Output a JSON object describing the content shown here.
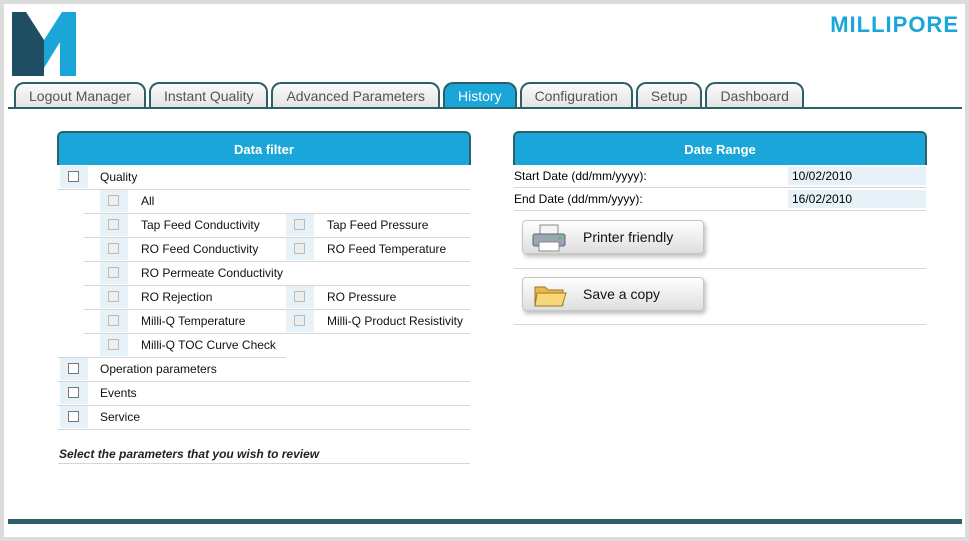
{
  "brand": "MILLIPORE",
  "logo_letter": "M",
  "tabs": [
    "Logout Manager",
    "Instant Quality",
    "Advanced Parameters",
    "History",
    "Configuration",
    "Setup",
    "Dashboard"
  ],
  "active_tab": "History",
  "data_filter": {
    "title": "Data filter",
    "quality": "Quality",
    "all": "All",
    "params_left": [
      "Tap Feed Conductivity",
      "RO Feed Conductivity",
      "RO Permeate Conductivity",
      "RO Rejection",
      "Milli-Q Temperature",
      "Milli-Q TOC Curve Check"
    ],
    "params_right": [
      "Tap Feed Pressure",
      "RO Feed Temperature",
      "",
      "RO Pressure",
      "Milli-Q Product Resistivity",
      ""
    ],
    "operation": "Operation parameters",
    "events": "Events",
    "service": "Service",
    "hint": "Select the parameters that you wish to review"
  },
  "date_range": {
    "title": "Date Range",
    "start_label": "Start Date (dd/mm/yyyy):",
    "start_value": "10/02/2010",
    "end_label": "End Date (dd/mm/yyyy):",
    "end_value": "16/02/2010",
    "print_label": "Printer friendly",
    "save_label": "Save a copy"
  },
  "colors": {
    "accent": "#1aa6d8",
    "dark": "#2d5f68"
  },
  "icons": [
    "printer-icon",
    "folder-icon"
  ]
}
